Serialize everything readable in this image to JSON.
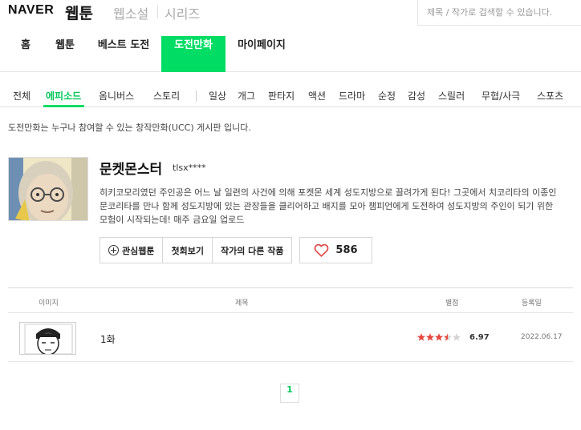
{
  "header": {
    "logo": "NAVER",
    "services": [
      "웹툰",
      "웹소설",
      "시리즈"
    ],
    "search_placeholder": "제목 / 작가로 검색할 수 있습니다."
  },
  "gnb": {
    "items": [
      "홈",
      "웹툰",
      "베스트 도전",
      "도전만화",
      "마이페이지"
    ],
    "active": "도전만화"
  },
  "subnav": {
    "items": [
      "전체",
      "에피소드",
      "옴니버스",
      "스토리",
      "일상",
      "개그",
      "판타지",
      "액션",
      "드라마",
      "순정",
      "감성",
      "스릴러",
      "무협/사극",
      "스포츠"
    ],
    "active": "에피소드"
  },
  "description": "도전만화는 누구나 참여할 수 있는 창작만화(UCC) 게시판 입니다.",
  "comic": {
    "title": "문켓몬스터",
    "author": "tlsx****",
    "synopsis": "히키코모리였던 주인공은 어느 날 일련의 사건에 의해 포켓몬 세계 성도지방으로 끌려가게 된다! 그곳에서 치코리타의 이종인 문코리타를 만나 함께 성도지방에 있는 관장들을 클리어하고 배지를 모아 챔피언에게 도전하여 성도지방의 주인이 되기 위한 모험이 시작되는데! 매주 금요일 업로드",
    "buttons": {
      "favorite": "관심웹툰",
      "first_episode": "첫회보기",
      "other_works": "작가의 다른 작품"
    },
    "likes": "586"
  },
  "table": {
    "headers": {
      "image": "이미지",
      "title": "제목",
      "rating": "별점",
      "date": "등록일"
    },
    "rows": [
      {
        "title": "1화",
        "rating": "6.97",
        "stars": 3.5,
        "date": "2022.06.17"
      }
    ]
  },
  "pagination": {
    "current": "1"
  },
  "colors": {
    "accent": "#00dc64",
    "star": "#e6473f",
    "heart": "#e14b4b"
  }
}
